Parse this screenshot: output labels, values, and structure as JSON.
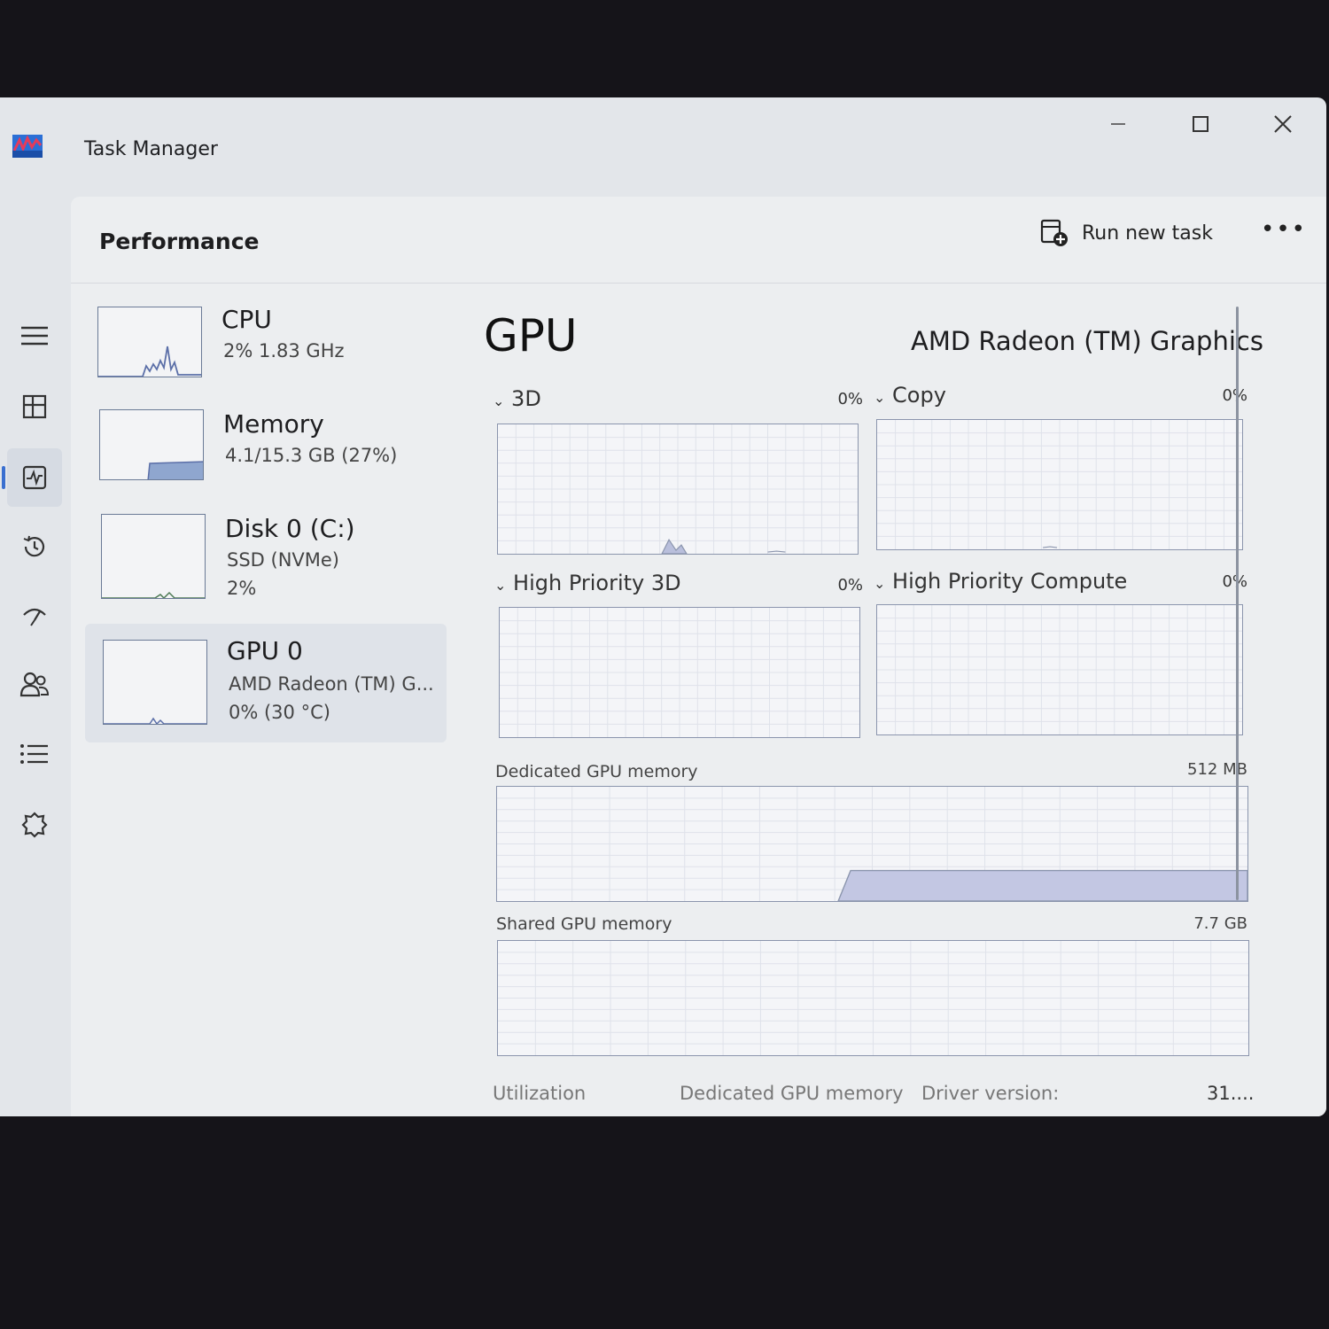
{
  "window": {
    "title": "Task Manager"
  },
  "header": {
    "page_title": "Performance",
    "run_task_label": "Run new task",
    "more_label": "•••"
  },
  "nav": [
    {
      "icon": "hamburger-icon"
    },
    {
      "icon": "processes-icon"
    },
    {
      "icon": "performance-icon",
      "active": true
    },
    {
      "icon": "app-history-icon"
    },
    {
      "icon": "startup-apps-icon"
    },
    {
      "icon": "users-icon"
    },
    {
      "icon": "details-icon"
    },
    {
      "icon": "services-icon"
    },
    {
      "icon": "settings-icon"
    }
  ],
  "devices": [
    {
      "name": "CPU",
      "line1": "2%  1.83 GHz",
      "line2": ""
    },
    {
      "name": "Memory",
      "line1": "4.1/15.3 GB (27%)",
      "line2": ""
    },
    {
      "name": "Disk 0 (C:)",
      "line1": "SSD (NVMe)",
      "line2": "2%"
    },
    {
      "name": "GPU 0",
      "line1": "AMD Radeon (TM) G...",
      "line2": "0%  (30 °C)",
      "selected": true
    }
  ],
  "gpu": {
    "title": "GPU",
    "model": "AMD Radeon (TM) Graphics",
    "engines": [
      {
        "label": "3D",
        "pct": "0%"
      },
      {
        "label": "Copy",
        "pct": "0%"
      },
      {
        "label": "High Priority 3D",
        "pct": "0%"
      },
      {
        "label": "High Priority Compute",
        "pct": "0%"
      }
    ],
    "dedicated": {
      "label": "Dedicated GPU memory",
      "max": "512 MB"
    },
    "shared": {
      "label": "Shared GPU memory",
      "max": "7.7 GB"
    },
    "stats": [
      {
        "label": "Utilization"
      },
      {
        "label": "Dedicated GPU memory"
      },
      {
        "label": "Driver version:"
      },
      {
        "label": "31...."
      }
    ]
  },
  "colors": {
    "graph_line": "#8b95ad",
    "graph_fill": "#b9bfdc",
    "accent": "#3a6fd0"
  }
}
